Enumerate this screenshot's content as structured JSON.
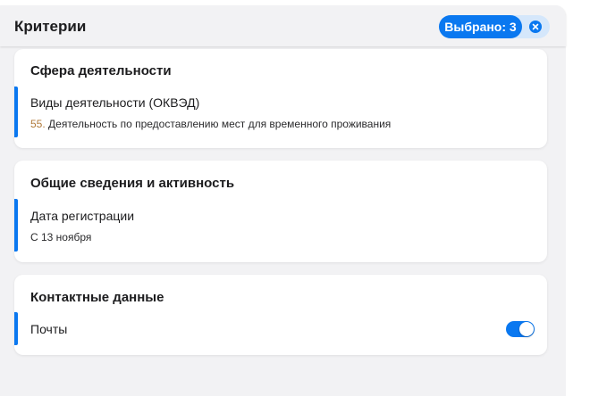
{
  "header": {
    "title": "Критерии",
    "selected_label": "Выбрано: 3",
    "clear_icon": "close-icon"
  },
  "sections": [
    {
      "title": "Сфера деятельности",
      "criteria": [
        {
          "title": "Виды деятельности (ОКВЭД)",
          "value_code": "55.",
          "value_text": " Деятельность по предоставлению мест для временного проживания"
        }
      ]
    },
    {
      "title": "Общие сведения и активность",
      "criteria": [
        {
          "title": "Дата регистрации",
          "value_text": "С 13 ноября"
        }
      ]
    },
    {
      "title": "Контактные данные",
      "criteria": [
        {
          "title": "Почты",
          "toggle_on": true
        }
      ]
    }
  ],
  "colors": {
    "accent": "#0a78f0",
    "code": "#b07a3a",
    "panel_bg": "#f2f2f4"
  }
}
